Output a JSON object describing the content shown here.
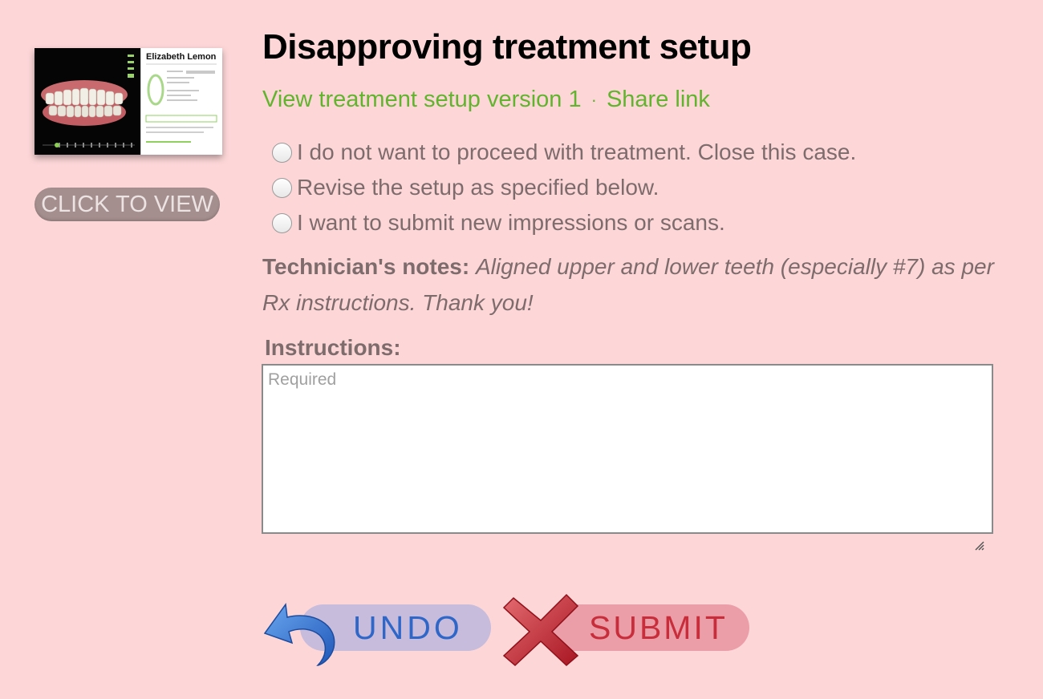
{
  "thumbnail": {
    "patient_name": "Elizabeth Lemon",
    "click_label": "CLICK TO VIEW"
  },
  "page": {
    "title": "Disapproving treatment setup"
  },
  "links": {
    "view_setup": "View treatment setup version 1",
    "separator": "·",
    "share": "Share link"
  },
  "options": [
    {
      "label": "I do not want to proceed with treatment. Close this case.",
      "selected": false
    },
    {
      "label": "Revise the setup as specified below.",
      "selected": false
    },
    {
      "label": "I want to submit new impressions or scans.",
      "selected": false
    }
  ],
  "notes": {
    "label": "Technician's notes:",
    "text": "Aligned upper and lower teeth (especially #7) as per Rx instructions. Thank you!"
  },
  "instructions": {
    "label": "Instructions:",
    "placeholder": "Required",
    "value": ""
  },
  "buttons": {
    "undo": "UNDO",
    "submit": "SUBMIT"
  },
  "colors": {
    "background": "#fdd7d8",
    "link_green": "#62b32e",
    "text_muted": "#7e6b6b",
    "undo_blue": "#2f67c9",
    "submit_red": "#c82d3b"
  },
  "icons": {
    "undo": "undo-arrow-icon",
    "submit": "red-x-icon",
    "resize": "resize-grip-icon"
  }
}
